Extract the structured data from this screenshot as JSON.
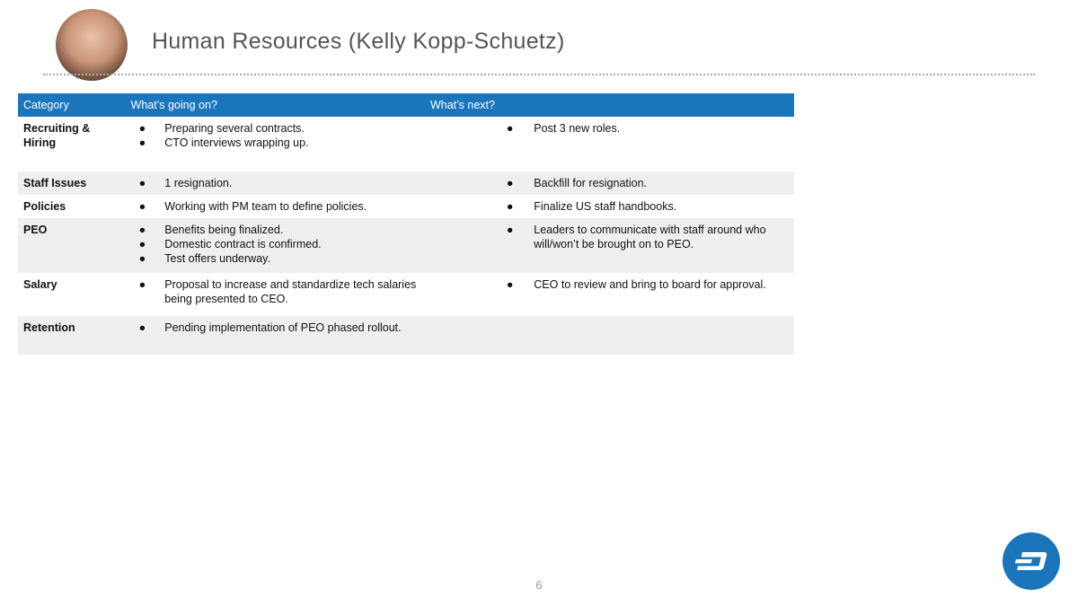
{
  "header": {
    "title": "Human Resources (Kelly Kopp-Schuetz)"
  },
  "table": {
    "columns": [
      "Category",
      "What’s going on?",
      "What’s next?"
    ],
    "rows": [
      {
        "category": [
          "Recruiting &",
          "Hiring"
        ],
        "going_on": [
          "Preparing several contracts.",
          "CTO interviews wrapping up."
        ],
        "next": [
          "Post 3 new roles."
        ]
      },
      {
        "category": [
          "Staff Issues"
        ],
        "going_on": [
          "1 resignation."
        ],
        "next": [
          "Backfill for resignation."
        ]
      },
      {
        "category": [
          "Policies"
        ],
        "going_on": [
          "Working with PM team to define policies."
        ],
        "next": [
          "Finalize US staff handbooks."
        ]
      },
      {
        "category": [
          "PEO"
        ],
        "going_on": [
          "Benefits being finalized.",
          "Domestic contract is confirmed.",
          "Test offers underway."
        ],
        "next": [
          "Leaders to communicate with staff around who will/won’t be brought on to PEO."
        ]
      },
      {
        "category": [
          "Salary"
        ],
        "going_on": [
          "Proposal to increase and standardize tech salaries being presented to CEO."
        ],
        "next": [
          "CEO to review and bring to board for approval."
        ]
      },
      {
        "category": [
          "Retention"
        ],
        "going_on": [
          "Pending implementation of PEO phased rollout."
        ],
        "next": []
      }
    ],
    "bullet": "●"
  },
  "footer": {
    "page_number": "6",
    "logo_icon": "dash-logo-icon"
  },
  "colors": {
    "header_bg": "#1b75bb",
    "shade_row": "#efefef",
    "title": "#555555"
  }
}
